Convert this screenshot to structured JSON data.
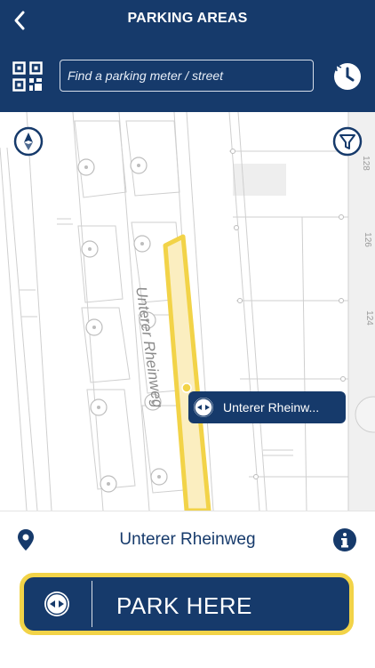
{
  "header": {
    "title": "PARKING AREAS",
    "back_icon": "chevron-left-icon",
    "qr_icon": "qr-code-icon",
    "history_icon": "history-icon"
  },
  "search": {
    "placeholder": "Find a parking meter / street",
    "value": ""
  },
  "map": {
    "street_label": "Unterer Rheinweg",
    "house_numbers": [
      "128",
      "126",
      "124"
    ],
    "compass_icon": "compass-icon",
    "filter_icon": "filter-icon",
    "marker": {
      "icon": "parking-meter-icon",
      "label": "Unterer Rheinw..."
    }
  },
  "location": {
    "pin_icon": "location-pin-icon",
    "name": "Unterer Rheinweg",
    "info_icon": "info-icon"
  },
  "action": {
    "label": "PARK HERE",
    "icon": "parking-meter-icon"
  },
  "colors": {
    "primary": "#163a6b",
    "highlight": "#f2d348",
    "segment_fill": "#fbeec0",
    "map_lines": "#cfcfcf"
  }
}
